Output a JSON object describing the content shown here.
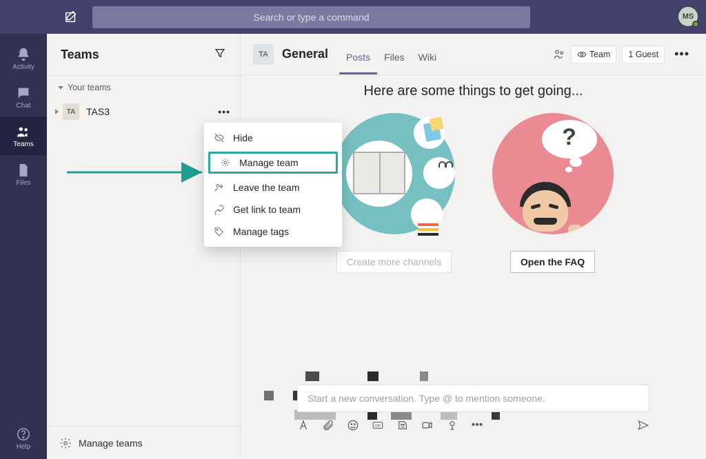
{
  "colors": {
    "accent": "#6264a7",
    "highlight": "#2ea99d"
  },
  "topbar": {
    "search_placeholder": "Search or type a command",
    "avatar_initials": "MS"
  },
  "rail": {
    "items": [
      {
        "id": "activity",
        "label": "Activity"
      },
      {
        "id": "chat",
        "label": "Chat"
      },
      {
        "id": "teams",
        "label": "Teams",
        "active": true
      },
      {
        "id": "files",
        "label": "Files"
      }
    ],
    "help_label": "Help"
  },
  "teams_col": {
    "title": "Teams",
    "section_label": "Your teams",
    "team": {
      "avatar": "TA",
      "name": "TAS3"
    },
    "manage_label": "Manage teams"
  },
  "context_menu": {
    "items": [
      {
        "id": "hide",
        "label": "Hide"
      },
      {
        "id": "manage",
        "label": "Manage team",
        "highlighted": true
      },
      {
        "id": "leave",
        "label": "Leave the team"
      },
      {
        "id": "link",
        "label": "Get link to team"
      },
      {
        "id": "tags",
        "label": "Manage tags"
      }
    ]
  },
  "channel": {
    "avatar": "TA",
    "name": "General",
    "tabs": [
      {
        "id": "posts",
        "label": "Posts",
        "active": true
      },
      {
        "id": "files",
        "label": "Files"
      },
      {
        "id": "wiki",
        "label": "Wiki"
      }
    ],
    "privacy_label": "Team",
    "guest_label": "1 Guest"
  },
  "content": {
    "headline": "Here are some things to get going...",
    "tile1_button": "Create more channels",
    "tile2_button": "Open the FAQ"
  },
  "compose": {
    "placeholder": "Start a new conversation. Type @ to mention someone."
  }
}
